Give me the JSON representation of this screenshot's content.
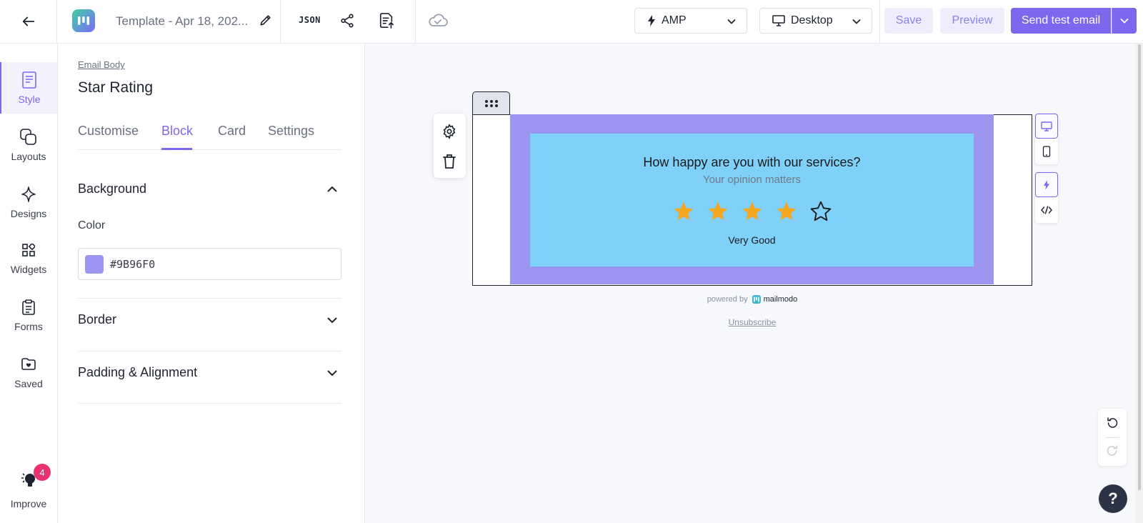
{
  "topbar": {
    "title": "Template - Apr 18, 202...",
    "json_label": "JSON",
    "amp_label": "AMP",
    "view_label": "Desktop",
    "save_label": "Save",
    "preview_label": "Preview",
    "send_label": "Send test email"
  },
  "leftnav": {
    "items": [
      {
        "label": "Style",
        "icon": "style-icon"
      },
      {
        "label": "Layouts",
        "icon": "layouts-icon"
      },
      {
        "label": "Designs",
        "icon": "sparkle-icon"
      },
      {
        "label": "Widgets",
        "icon": "widgets-icon"
      },
      {
        "label": "Forms",
        "icon": "clipboard-icon"
      },
      {
        "label": "Saved",
        "icon": "folder-heart-icon"
      }
    ],
    "improve_label": "Improve",
    "improve_badge": "4"
  },
  "panel": {
    "breadcrumb": "Email Body",
    "title": "Star Rating",
    "tabs": [
      "Customise",
      "Block",
      "Card",
      "Settings"
    ],
    "active_tab": "Block",
    "background_label": "Background",
    "color_label": "Color",
    "color_value": "#9B96F0",
    "border_label": "Border",
    "padding_label": "Padding & Alignment"
  },
  "email": {
    "question": "How happy are you with our services?",
    "subtitle": "Your opinion matters",
    "rating": 4,
    "max_rating": 5,
    "rating_label": "Very Good",
    "powered_by": "powered by",
    "brand": "mailmodo",
    "unsubscribe": "Unsubscribe",
    "block_bg": "#9B96F0",
    "card_bg": "#7FD1F9",
    "star_color": "#F5A623"
  },
  "colors": {
    "accent": "#7B68EE",
    "badge": "#E8336F"
  },
  "help_label": "?"
}
